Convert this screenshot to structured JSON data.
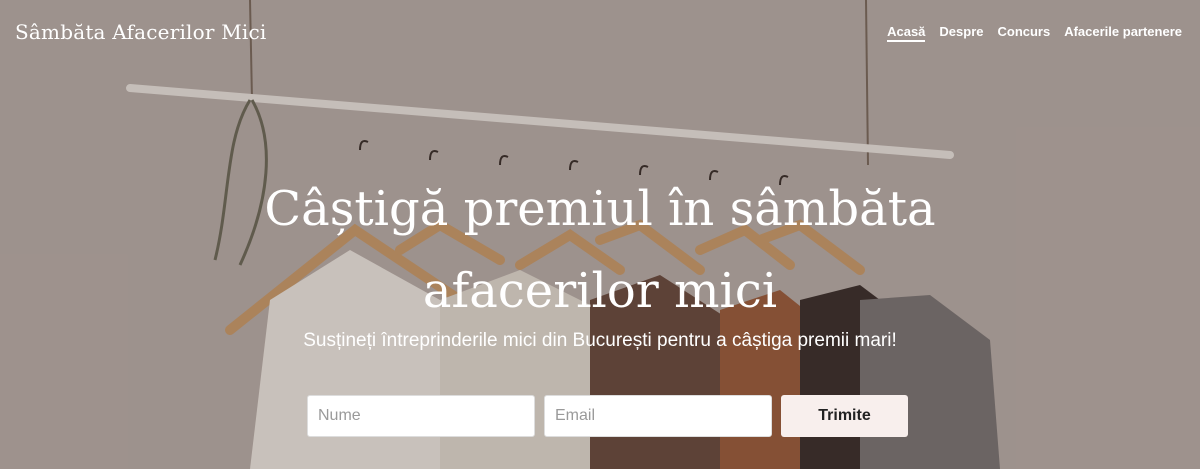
{
  "brand": {
    "title": "Sâmbăta Afacerilor Mici"
  },
  "nav": {
    "items": [
      {
        "label": "Acasă",
        "active": true
      },
      {
        "label": "Despre"
      },
      {
        "label": "Concurs"
      },
      {
        "label": "Afacerile partenere"
      }
    ]
  },
  "hero": {
    "headline_line1": "Câștigă premiul în sâmbăta",
    "headline_line2": "afacerilor mici",
    "subtitle": "Susțineți întreprinderile mici din București pentru a câștiga premii mari!"
  },
  "form": {
    "name_placeholder": "Nume",
    "email_placeholder": "Email",
    "submit_label": "Trimite"
  },
  "colors": {
    "button_bg": "#f8efed",
    "text": "#ffffff"
  }
}
